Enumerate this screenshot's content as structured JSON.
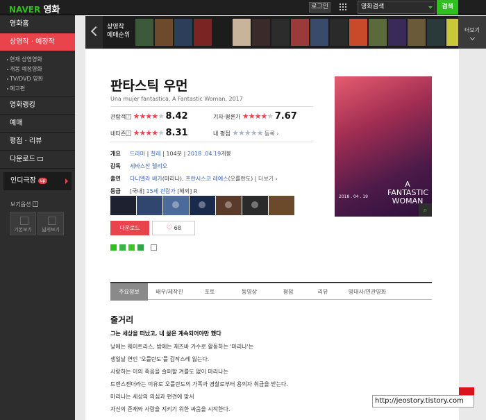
{
  "topbar": {
    "brand_naver": "NAVER",
    "brand_movie": "영화",
    "login_label": "로그인",
    "search_category": "영화검색",
    "search_button": "검색"
  },
  "sidebar": {
    "home": "영화홈",
    "now_showing": "상영작 · 예정작",
    "sub_items": [
      "현재 상영영화",
      "개봉 예정영화",
      "TV/DVD 영화",
      "예고편"
    ],
    "ranking": "영화랭킹",
    "booking": "예매",
    "reviews": "평점 · 리뷰",
    "download": "다운로드",
    "indie": "인디극장",
    "indie_badge": "up",
    "view_options": "보기옵션",
    "view_basic": "기본보기",
    "view_wide": "넓게보기"
  },
  "strip": {
    "caption_line1": "상영작",
    "caption_line2": "예매순위",
    "more_label": "더보기",
    "poster_colors": [
      "#3c5a3a",
      "#6d4a2c",
      "#2c3e5a",
      "#7a2424",
      "#1c1c1c",
      "#c8b49a",
      "#3a2a2a",
      "#2c2c2c",
      "#9a3a3a",
      "#3a4a6a",
      "#2a2a2a",
      "#c84a2a",
      "#5a6a3a",
      "#3a2a5a",
      "#6a5a3a",
      "#2a3a3a",
      "#c8c83a"
    ]
  },
  "movie": {
    "title": "판타스틱 우먼",
    "subtitle": "Una mujer fantastica, A Fantastic Woman, 2017",
    "audience_label": "관람객",
    "audience_score": "8.42",
    "critic_label": "기자·평론가",
    "critic_score": "7.67",
    "netizen_label": "네티즌",
    "netizen_score": "8.31",
    "my_rating_label": "내 평점",
    "register_label": "등록",
    "overview_label": "개요",
    "genre": "드라마",
    "country": "칠레",
    "runtime": "104분",
    "release": "2018 .04.19",
    "release_suffix": "개봉",
    "director_label": "감독",
    "director": "세바스찬 렐리오",
    "cast_label": "출연",
    "cast1": "다니엘라 베가",
    "cast1_role": "(마리나),",
    "cast2": "프란시스코 레예스",
    "cast2_role": "(오를란도)",
    "cast_more": "더보기",
    "grade_label": "등급",
    "grade_prefix": "[국내]",
    "grade": "15세 관람가",
    "grade_foreign": "[해외]",
    "grade_foreign_val": "R",
    "download_button": "다운로드",
    "like_count": "68",
    "poster_text": "A FANTASTIC WOMAN",
    "poster_date": "2018 . 04 . 19"
  },
  "stills": [
    "#1e2230",
    "#30466e",
    "#4c6a9a",
    "#1a2a4a",
    "#5a3a2a",
    "#2a2a2a",
    "#6a4a2a"
  ],
  "tabs": [
    "주요정보",
    "배우/제작진",
    "포토",
    "동영상",
    "평점",
    "리뷰",
    "명대사/연관영화"
  ],
  "synopsis": {
    "heading": "줄거리",
    "tagline": "그는 세상을 떠났고, 내 삶은 계속되어야만 했다",
    "lines": [
      "낮에는 웨이트리스, 밤에는 재즈바 가수로 활동하는 '마리나'는",
      "생일날 연인 '오를란도'를 갑작스레 잃는다.",
      "사랑하는 이의 죽음을 슬퍼할 겨를도 없이 마리나는",
      "트랜스젠더라는 이유로 오를란도의 가족과 경찰로부터 용의자 취급을 받는다.",
      "마리나는 세상의 의심과 편견에 맞서",
      "자신의 존재와 사랑을 지키기 위한 싸움을 시작한다."
    ]
  },
  "watermark": "http://jeostory.tistory.com"
}
